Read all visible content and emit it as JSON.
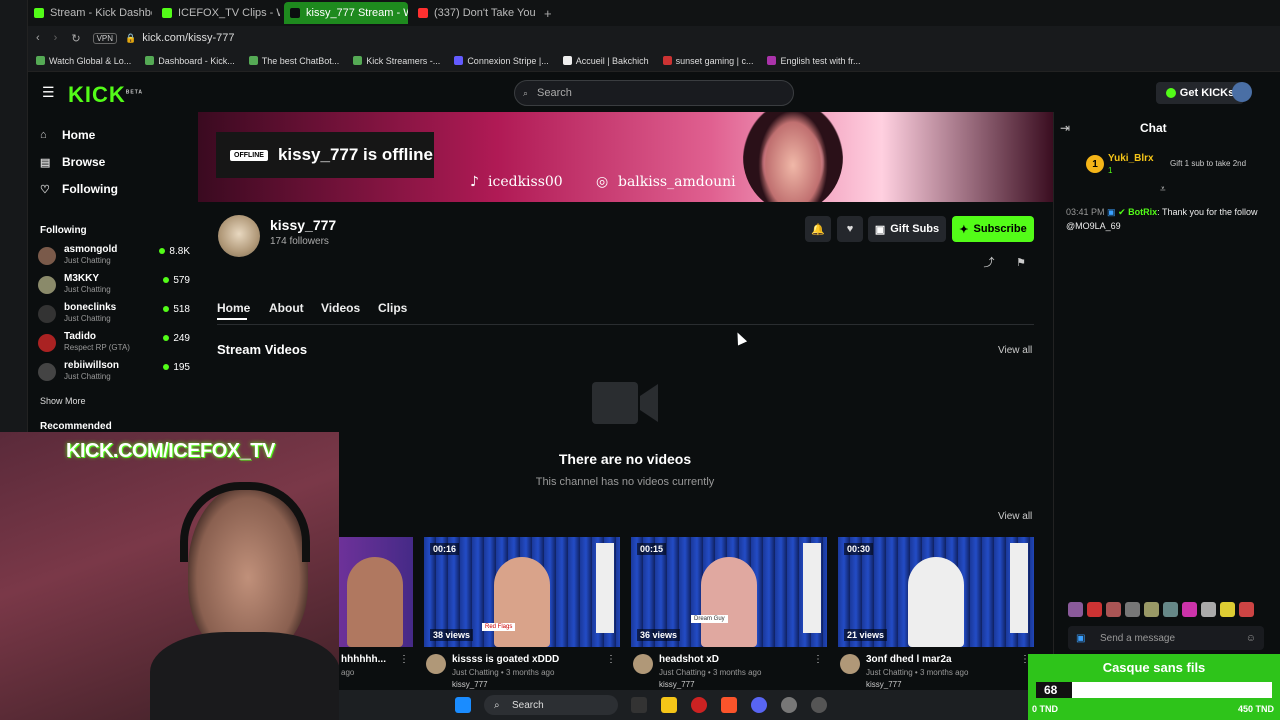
{
  "browser": {
    "tabs": [
      {
        "label": "Stream - Kick Dashboard",
        "active": false
      },
      {
        "label": "ICEFOX_TV Clips - Watch",
        "active": false
      },
      {
        "label": "kissy_777 Stream - Watch",
        "active": true
      },
      {
        "label": "(337) Don't Take Your",
        "active": false
      }
    ],
    "url": "kick.com/kissy-777",
    "vpn_label": "VPN",
    "bookmarks": [
      "Watch Global & Lo...",
      "Dashboard - Kick...",
      "The best ChatBot...",
      "Kick Streamers -...",
      "Connexion Stripe |...",
      "Accueil | Bakchich",
      "sunset gaming | c...",
      "English test with fr..."
    ]
  },
  "header": {
    "logo": "KICK",
    "logo_badge": "BETA",
    "search_placeholder": "Search",
    "get_kicks_label": "Get KICKs"
  },
  "nav": {
    "home": "Home",
    "browse": "Browse",
    "following": "Following",
    "following_section": "Following",
    "show_more": "Show More",
    "recommended": "Recommended",
    "channels": [
      {
        "name": "asmongold",
        "category": "Just Chatting",
        "viewers": "8.8K"
      },
      {
        "name": "M3KKY",
        "category": "Just Chatting",
        "viewers": "579"
      },
      {
        "name": "boneclinks",
        "category": "Just Chatting",
        "viewers": "518"
      },
      {
        "name": "Tadido",
        "category": "Respect RP (GTA)",
        "viewers": "249"
      },
      {
        "name": "rebiiwillson",
        "category": "Just Chatting",
        "viewers": "195"
      }
    ]
  },
  "banner": {
    "offline_badge": "OFFLINE",
    "offline_text": "kissy_777 is offline",
    "tiktok": "icedkiss00",
    "instagram": "balkiss_amdouni"
  },
  "channel": {
    "name": "kissy_777",
    "followers": "174 followers",
    "gift_label": "Gift Subs",
    "subscribe_label": "Subscribe",
    "tabs": [
      "Home",
      "About",
      "Videos",
      "Clips"
    ],
    "stream_videos_title": "Stream Videos",
    "view_all": "View all",
    "no_videos_title": "There are no videos",
    "no_videos_sub": "This channel has no videos currently"
  },
  "clips": [
    {
      "duration": "",
      "views": "",
      "title": "hhhhhh...",
      "meta": "ago",
      "user": ""
    },
    {
      "duration": "00:16",
      "views": "38 views",
      "title": "kissss is goated xDDD",
      "meta": "Just Chatting • 3 months ago",
      "user": "kissy_777",
      "overlay": "Red Flags"
    },
    {
      "duration": "00:15",
      "views": "36 views",
      "title": "headshot xD",
      "meta": "Just Chatting • 3 months ago",
      "user": "kissy_777",
      "overlay": "Dream Guy"
    },
    {
      "duration": "00:30",
      "views": "21 views",
      "title": "3onf dhed l mar2a",
      "meta": "Just Chatting • 3 months ago",
      "user": "kissy_777"
    }
  ],
  "webcam": {
    "overlay_text": "KICK.COM/ICEFOX_TV"
  },
  "chat": {
    "title": "Chat",
    "pinned_user": "Yuki_Blrx",
    "pinned_rank": "1",
    "pinned_count": "1",
    "pinned_text": "Gift 1 sub to take 2nd",
    "message": {
      "time": "03:41 PM",
      "user": "BotRix",
      "text": "Thank you for the follow @MO9LA_69"
    },
    "input_placeholder": "Send a message"
  },
  "goal": {
    "title": "Casque sans fils",
    "value": "68",
    "progress_fraction": 0.151,
    "min_label": "0 TND",
    "max_label": "450 TND"
  },
  "taskbar": {
    "search_label": "Search"
  },
  "colors": {
    "accent": "#53fc18",
    "goal": "#2ec41a",
    "background": "#0b0e0f"
  }
}
